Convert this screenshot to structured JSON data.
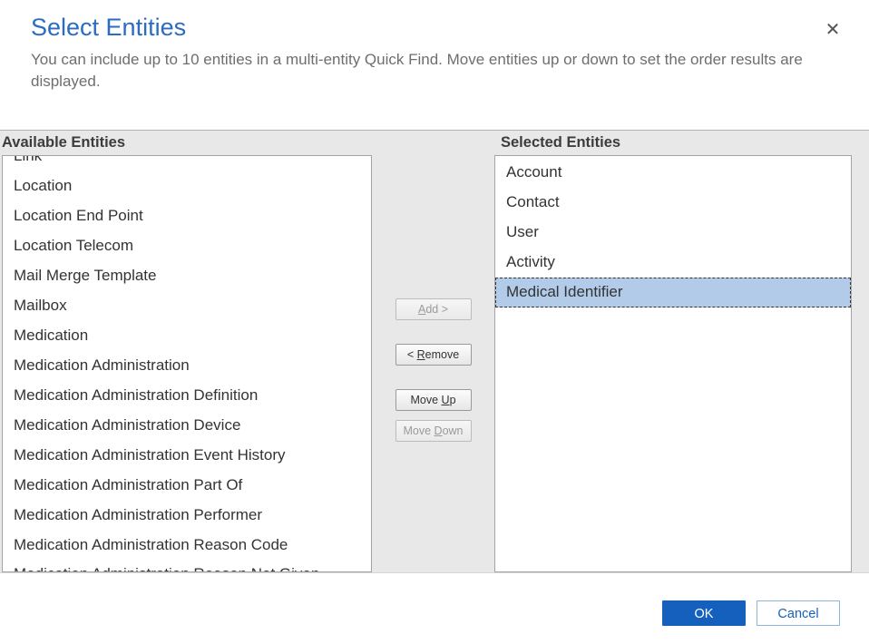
{
  "header": {
    "title": "Select Entities",
    "subtitle": "You can include up to 10 entities in a multi-entity Quick Find. Move entities up or down to set the order results are displayed.",
    "close_icon": "✕"
  },
  "labels": {
    "available": "Available Entities",
    "selected": "Selected Entities"
  },
  "available_entities": [
    "Link",
    "Location",
    "Location End Point",
    "Location Telecom",
    "Mail Merge Template",
    "Mailbox",
    "Medication",
    "Medication Administration",
    "Medication Administration Definition",
    "Medication Administration Device",
    "Medication Administration Event History",
    "Medication Administration Part Of",
    "Medication Administration Performer",
    "Medication Administration Reason Code",
    "Medication Administration Reason Not Given"
  ],
  "selected_entities": [
    {
      "label": "Account",
      "selected": false
    },
    {
      "label": "Contact",
      "selected": false
    },
    {
      "label": "User",
      "selected": false
    },
    {
      "label": "Activity",
      "selected": false
    },
    {
      "label": "Medical Identifier",
      "selected": true
    }
  ],
  "buttons": {
    "add": {
      "prefix": "",
      "ul": "A",
      "suffix": "dd >",
      "enabled": false
    },
    "remove": {
      "prefix": "< ",
      "ul": "R",
      "suffix": "emove",
      "enabled": true
    },
    "move_up": {
      "prefix": "Move ",
      "ul": "U",
      "suffix": "p",
      "enabled": true
    },
    "move_down": {
      "prefix": "Move ",
      "ul": "D",
      "suffix": "own",
      "enabled": false
    }
  },
  "footer": {
    "ok": "OK",
    "cancel": "Cancel"
  }
}
